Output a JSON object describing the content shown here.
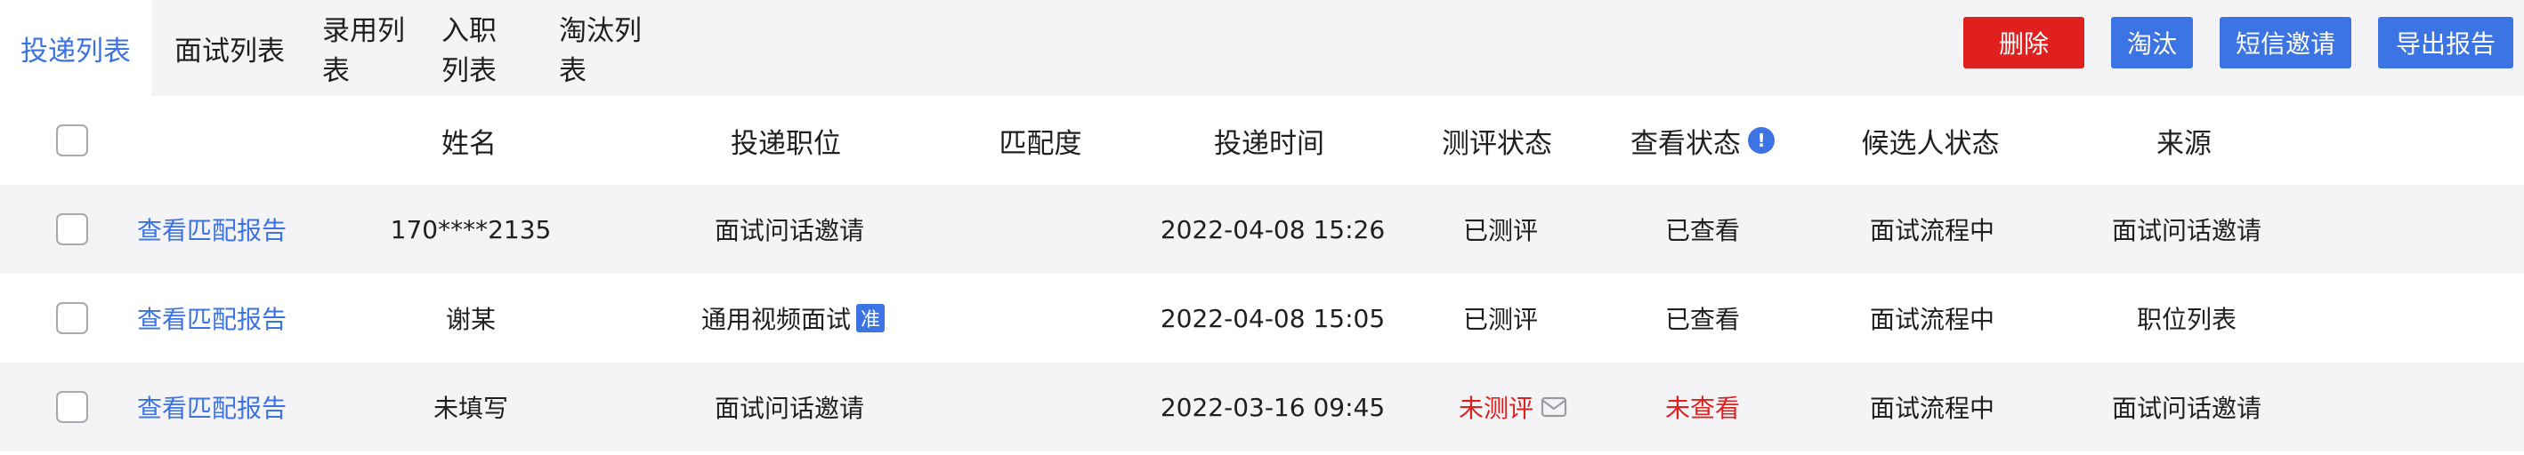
{
  "tabs": [
    {
      "label": "投递列表",
      "active": true
    },
    {
      "label": "面试列表",
      "active": false
    },
    {
      "label": "录用列表",
      "active": false
    },
    {
      "label": "入职列表",
      "active": false
    },
    {
      "label": "淘汰列表",
      "active": false
    }
  ],
  "actions": {
    "delete": "删除",
    "eliminate": "淘汰",
    "sms_invite": "短信邀请",
    "export_report": "导出报告"
  },
  "columns": {
    "name": "姓名",
    "position": "投递职位",
    "match": "匹配度",
    "time": "投递时间",
    "assessment": "测评状态",
    "view": "查看状态",
    "candidate_status": "候选人状态",
    "source": "来源"
  },
  "rows": [
    {
      "link": "查看匹配报告",
      "name": "170****2135",
      "position": "面试问话邀请",
      "badge": "",
      "match": "",
      "time": "2022-04-08 15:26",
      "assessment": "已测评",
      "view": "已查看",
      "candidate_status": "面试流程中",
      "source": "面试问话邀请"
    },
    {
      "link": "查看匹配报告",
      "name": "谢某",
      "position": "通用视频面试",
      "badge": "准",
      "match": "",
      "time": "2022-04-08 15:05",
      "assessment": "已测评",
      "view": "已查看",
      "candidate_status": "面试流程中",
      "source": "职位列表"
    },
    {
      "link": "查看匹配报告",
      "name": "未填写",
      "position": "面试问话邀请",
      "badge": "",
      "match": "",
      "time": "2022-03-16 09:45",
      "assessment": "未测评",
      "view": "未查看",
      "candidate_status": "面试流程中",
      "source": "面试问话邀请"
    }
  ],
  "icons": {
    "info": "info-icon",
    "mail": "mail-icon"
  },
  "colors": {
    "accent": "#3b73e3",
    "danger": "#e0201e",
    "stripe": "#f4f4f6"
  }
}
